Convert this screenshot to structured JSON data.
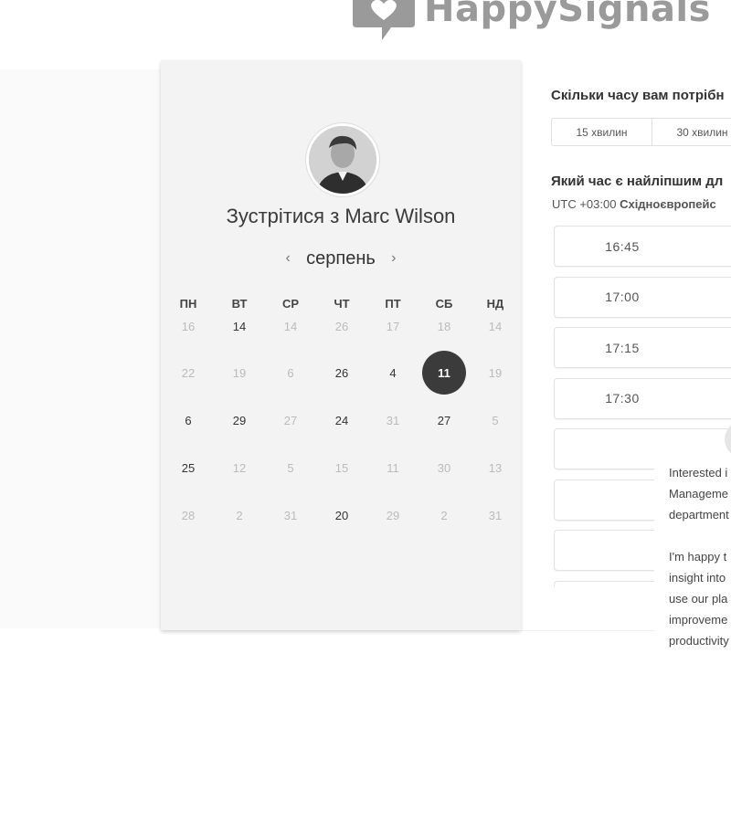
{
  "brand": {
    "name": "HappySignals",
    "logo_icon": "speech-bubble-heart-icon"
  },
  "calendar": {
    "title_prefix": "Зустрітися з",
    "host_name": "Marc Wilson",
    "month": "серпень",
    "prev_icon": "chevron-left-icon",
    "next_icon": "chevron-right-icon",
    "weekdays": [
      "ПН",
      "ВТ",
      "СР",
      "ЧТ",
      "ПТ",
      "СБ",
      "НД"
    ],
    "weeks": [
      [
        {
          "d": "16",
          "active": false
        },
        {
          "d": "14",
          "active": true
        },
        {
          "d": "14",
          "active": false
        },
        {
          "d": "26",
          "active": false
        },
        {
          "d": "17",
          "active": false
        },
        {
          "d": "18",
          "active": false
        },
        {
          "d": "14",
          "active": false
        }
      ],
      [
        {
          "d": "22",
          "active": false
        },
        {
          "d": "19",
          "active": false
        },
        {
          "d": "6",
          "active": false
        },
        {
          "d": "26",
          "active": true
        },
        {
          "d": "4",
          "active": true
        },
        {
          "d": "11",
          "active": true,
          "selected": true
        },
        {
          "d": "19",
          "active": false
        }
      ],
      [
        {
          "d": "6",
          "active": true
        },
        {
          "d": "29",
          "active": true
        },
        {
          "d": "27",
          "active": false
        },
        {
          "d": "24",
          "active": true
        },
        {
          "d": "31",
          "active": false
        },
        {
          "d": "27",
          "active": true
        },
        {
          "d": "5",
          "active": false
        }
      ],
      [
        {
          "d": "25",
          "active": true
        },
        {
          "d": "12",
          "active": false
        },
        {
          "d": "5",
          "active": false
        },
        {
          "d": "15",
          "active": false
        },
        {
          "d": "11",
          "active": false
        },
        {
          "d": "30",
          "active": false
        },
        {
          "d": "13",
          "active": false
        }
      ],
      [
        {
          "d": "28",
          "active": false
        },
        {
          "d": "2",
          "active": false
        },
        {
          "d": "31",
          "active": false
        },
        {
          "d": "20",
          "active": true
        },
        {
          "d": "29",
          "active": false
        },
        {
          "d": "2",
          "active": false
        },
        {
          "d": "31",
          "active": false
        }
      ]
    ]
  },
  "booking": {
    "duration_question": "Скільки часу вам потрібн",
    "durations": [
      "15 хвилин",
      "30 хвилин"
    ],
    "time_question": "Який час є найліпшим дл",
    "timezone_offset": "UTC +03:00",
    "timezone_name": "Східноєвропейс",
    "slots": [
      "16:45",
      "17:00",
      "17:15",
      "17:30",
      "",
      "",
      "",
      ""
    ]
  },
  "chat": {
    "lines": [
      "Interested i",
      "Manageme",
      "department",
      "",
      "I'm happy t",
      "insight into",
      "use our pla",
      "improveme",
      "productivity"
    ]
  }
}
